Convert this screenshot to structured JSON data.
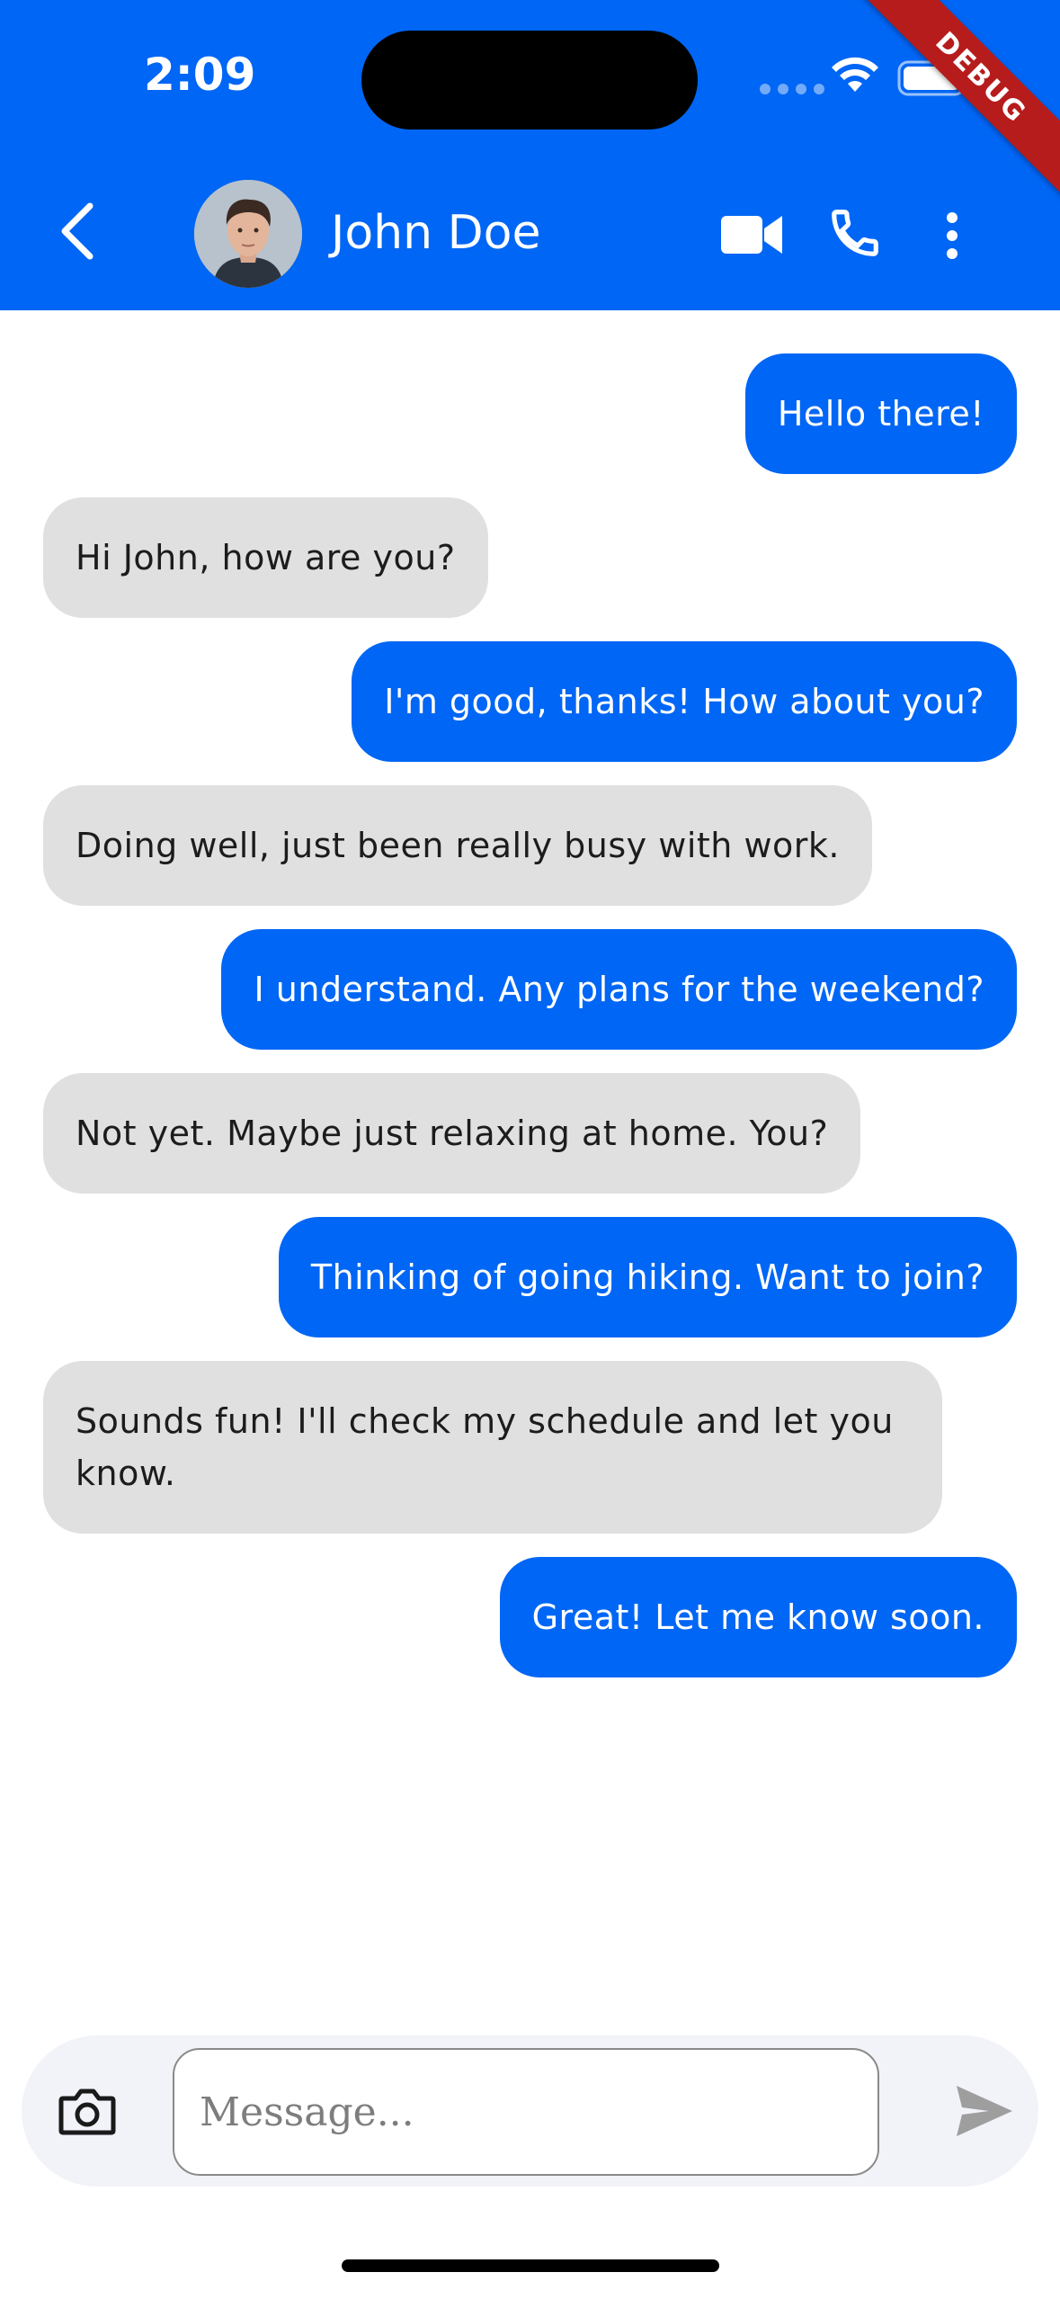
{
  "status_bar": {
    "time": "2:09"
  },
  "debug_banner": "DEBUG",
  "header": {
    "contact_name": "John Doe",
    "back_icon": "chevron-left-icon",
    "actions": [
      "video-call-icon",
      "phone-icon",
      "more-vert-icon"
    ]
  },
  "colors": {
    "primary": "#0066F5",
    "received_bubble": "#E0E0E0",
    "composer_bg": "#F1F3F8"
  },
  "messages": [
    {
      "text": "Hello there!",
      "sender": "me"
    },
    {
      "text": "Hi John, how are you?",
      "sender": "them"
    },
    {
      "text": "I'm good, thanks! How about you?",
      "sender": "me"
    },
    {
      "text": "Doing well, just been really busy with work.",
      "sender": "them"
    },
    {
      "text": "I understand. Any plans for the weekend?",
      "sender": "me"
    },
    {
      "text": "Not yet. Maybe just relaxing at home. You?",
      "sender": "them"
    },
    {
      "text": "Thinking of going hiking. Want to join?",
      "sender": "me"
    },
    {
      "text": "Sounds fun! I'll check my schedule and let you know.",
      "sender": "them"
    },
    {
      "text": "Great! Let me know soon.",
      "sender": "me"
    }
  ],
  "composer": {
    "placeholder": "Message...",
    "value": ""
  }
}
